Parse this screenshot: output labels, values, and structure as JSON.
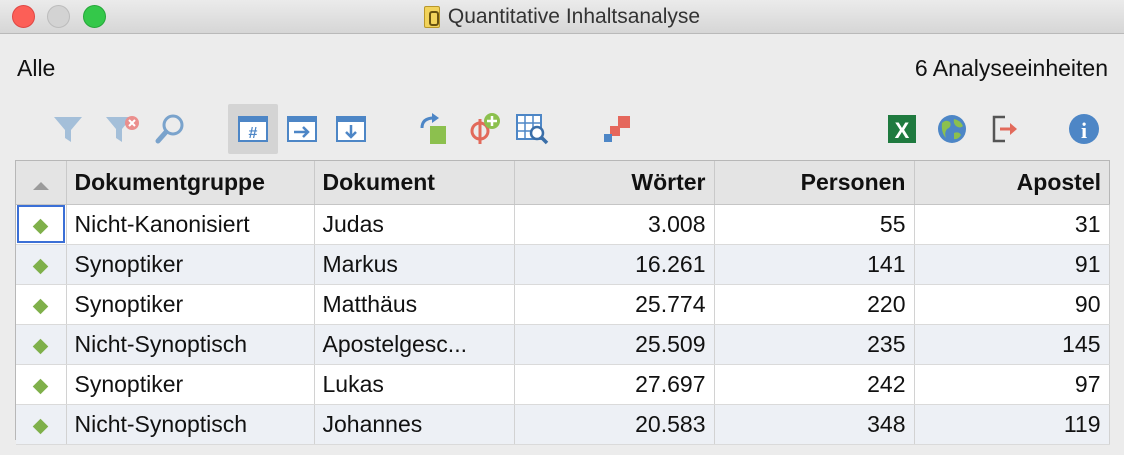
{
  "window": {
    "title": "Quantitative Inhaltsanalyse"
  },
  "header": {
    "filter_label": "Alle",
    "count_label": "6 Analyseeinheiten"
  },
  "toolbar": {
    "icons": [
      "filter-icon",
      "clear-filter-icon",
      "search-icon",
      "hash-grid-icon",
      "export-right-icon",
      "export-down-icon",
      "transfer-icon",
      "add-code-icon",
      "table-search-icon",
      "color-squares-icon",
      "excel-icon",
      "globe-icon",
      "exit-icon",
      "info-icon"
    ],
    "excel_glyph": "X",
    "info_glyph": "i",
    "hash_glyph": "#"
  },
  "table": {
    "columns": [
      "Dokumentgruppe",
      "Dokument",
      "Wörter",
      "Personen",
      "Apostel"
    ],
    "rows": [
      {
        "group": "Nicht-Kanonisiert",
        "document": "Judas",
        "words": "3.008",
        "persons": "55",
        "apostles": "31"
      },
      {
        "group": "Synoptiker",
        "document": "Markus",
        "words": "16.261",
        "persons": "141",
        "apostles": "91"
      },
      {
        "group": "Synoptiker",
        "document": "Matthäus",
        "words": "25.774",
        "persons": "220",
        "apostles": "90"
      },
      {
        "group": "Nicht-Synoptisch",
        "document": "Apostelgesc...",
        "words": "25.509",
        "persons": "235",
        "apostles": "145"
      },
      {
        "group": "Synoptiker",
        "document": "Lukas",
        "words": "27.697",
        "persons": "242",
        "apostles": "97"
      },
      {
        "group": "Nicht-Synoptisch",
        "document": "Johannes",
        "words": "20.583",
        "persons": "348",
        "apostles": "119"
      }
    ]
  },
  "colors": {
    "accent_green": "#7fb04a",
    "selection_blue": "#3b6fd6",
    "icon_blue": "#4d86c6",
    "excel_green": "#1f7a3f"
  }
}
